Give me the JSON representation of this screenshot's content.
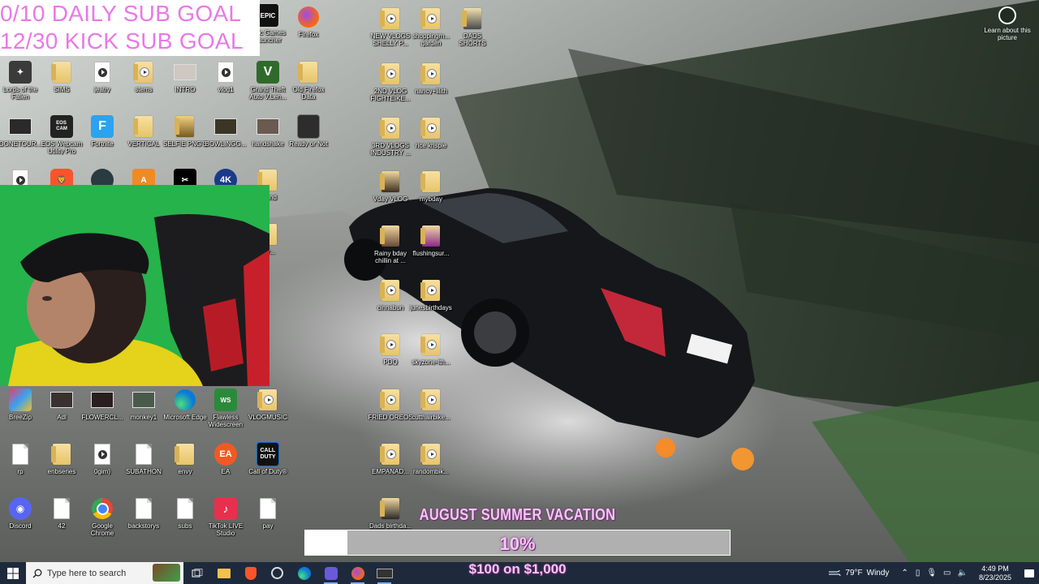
{
  "overlay": {
    "daily_goal": "0/10 DAILY SUB GOAL",
    "kick_goal": "12/30 KICK SUB GOAL",
    "goal_title": "AUGUST SUMMER VACATION",
    "goal_percent_text": "10%",
    "goal_progress": 0.1,
    "goal_amount": "$100 on $1,000"
  },
  "learn_about": "Learn about this picture",
  "icons": {
    "epic": "Epic Games Launcher",
    "firefox": "Firefox",
    "lords": "Lords of the Fallen",
    "sims": "SIMS",
    "jeatry": "jeatry",
    "stems": "stems",
    "intro": "INTRO",
    "vlog1": "vlog1",
    "gta": "Grand Theft Auto V.Len...",
    "oldff": "Old Firefox Data",
    "donetour": "DONETOUR...",
    "eos": "EOS Webcam Utility Pro",
    "fortnite": "Fortnite",
    "vertical": "VERTICAL",
    "selfie": "SELFIE PNG'S",
    "bowling": "BOWLINGG...",
    "handshake": "handshake",
    "ready": "Ready or Not",
    "breezip": "BreeZip",
    "adl": "Adl",
    "flowercl": "FLOWERCL...",
    "monkey": "monkey1",
    "edge": "Microsoft Edge",
    "flawless": "Flawless Widescreen",
    "vlogmusic": "VLOGMUSIC",
    "rp": "rp",
    "enbseries": "enbseries",
    "gim": "0gim)",
    "subathon": "SUBATHON",
    "envy": "envy",
    "ea": "EA",
    "cod": "Call of Duty®",
    "discord": "Discord",
    "n42": "42",
    "chrome": "Google Chrome",
    "backstorys": "backstorys",
    "subs": "subs",
    "tiktok": "TikTok LIVE Studio",
    "pay": "pay",
    "newvlogs": "NEW VLOGS SHELLY P...",
    "shopping": "shoppingm... garden",
    "dads": "DADS SHORTS",
    "vlog2": "2ND VLOG FIGHTEIKE...",
    "nancy": "nancy+lilith",
    "vlog3": "3RD VLOGS INDUSTRY ...",
    "ricekrispie": "rice krispie",
    "vday": "Vday VLOG",
    "mybday": "mybday",
    "rainy": "Rainy bday chillin at ...",
    "flushing": "flushingsur...",
    "cinnabun": "cinnabun",
    "junes": "junesbirthdays",
    "pdq": "PDQ",
    "skyzone": "skyzone-lth...",
    "friedoreos": "FRIED OREOS",
    "cutthair": "cutthairbike...",
    "empanad": "EMPANAD...",
    "randombk": "randombik...",
    "dads2": "Dads birthda...",
    "sound": "sound",
    "pr": "_pr..."
  },
  "taskbar": {
    "search_placeholder": "Type here to search",
    "temperature": "79°F",
    "weather": "Windy",
    "time": "4:49 PM",
    "date": "8/23/2025"
  },
  "colors": {
    "goal_pink": "#e879e6",
    "bar_text_pink": "#f6c5f6",
    "taskbar": "#1e2a3c"
  }
}
